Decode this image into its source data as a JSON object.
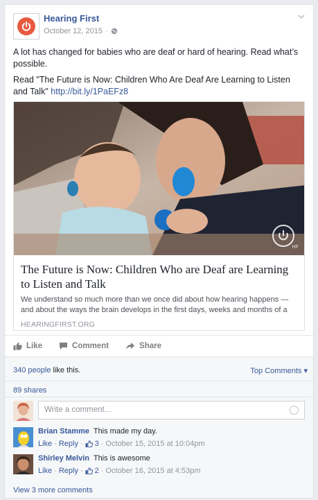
{
  "post": {
    "page_name": "Hearing First",
    "date": "October 12, 2015",
    "separator": "·",
    "text_line1": "A lot has changed for babies who are deaf or hard of hearing. Read what’s possible.",
    "text_line2_prefix": "Read \"The Future is Now: Children Who Are Deaf Are Learning to Listen and Talk\"",
    "text_line2_link": "http://bit.ly/1PaEFz8"
  },
  "link_preview": {
    "title": "The Future is Now: Children Who are Deaf are Learning to Listen and Talk",
    "description": "We understand so much more than we once did about how hearing happens — and about the ways the brain develops in the first days, weeks and months of a child’s...",
    "domain": "HEARINGFIRST.ORG",
    "watermark": "HF"
  },
  "actions": {
    "like": "Like",
    "comment": "Comment",
    "share": "Share"
  },
  "engagement": {
    "people_count": "340 people",
    "likes_suffix": "like this.",
    "top_comments": "Top Comments",
    "top_comments_arrow": "▾",
    "shares": "89 shares"
  },
  "composer": {
    "placeholder": "Write a comment..."
  },
  "comments": [
    {
      "author": "Brian Stamme",
      "text": "This made my day.",
      "like": "Like",
      "dot": "·",
      "reply": "Reply",
      "likes": "3",
      "timestamp": "October 15, 2015 at 10:04pm"
    },
    {
      "author": "Shirley Melvin",
      "text": "This is awesome",
      "like": "Like",
      "dot": "·",
      "reply": "Reply",
      "likes": "2",
      "timestamp": "October 16, 2015 at 4:53pm"
    }
  ],
  "view_more": "View 3 more comments",
  "colors": {
    "link_blue": "#365899",
    "brand_orange": "#e8593f",
    "muted_gray": "#90949c"
  }
}
